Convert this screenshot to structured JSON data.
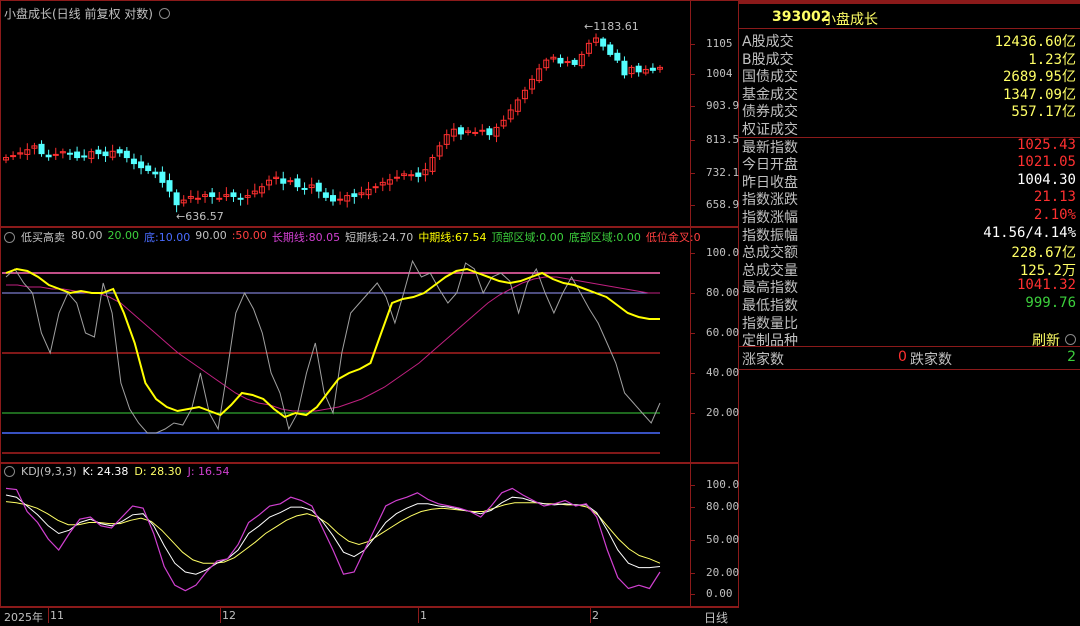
{
  "main_chart": {
    "title": "小盘成长(日线 前复权 对数)",
    "high_label": "1183.61",
    "low_label": "636.57",
    "y_ticks": [
      "1105",
      "1004",
      "903.9",
      "813.5",
      "732.1",
      "658.9"
    ]
  },
  "indicator1": {
    "name": "低买高卖",
    "items": [
      {
        "text": "80.00",
        "color": "#c0c0c0"
      },
      {
        "text": "20.00",
        "color": "#3cd03c"
      },
      {
        "text": "底:10.00",
        "color": "#4a6cff"
      },
      {
        "text": "90.00",
        "color": "#c0c0c0"
      },
      {
        "text": ":50.00",
        "color": "#ff4040"
      },
      {
        "text": "长期线:80.05",
        "color": "#d040d0"
      },
      {
        "text": "短期线:24.70",
        "color": "#c0c0c0"
      },
      {
        "text": "中期线:67.54",
        "color": "#ffff00"
      },
      {
        "text": "顶部区域:0.00",
        "color": "#3cd03c"
      },
      {
        "text": "底部区域:0.00",
        "color": "#3cd03c"
      },
      {
        "text": "低位金叉:0",
        "color": "#ff4040"
      }
    ],
    "y_ticks": [
      "100.0",
      "80.00",
      "60.00",
      "40.00",
      "20.00"
    ]
  },
  "indicator2": {
    "name": "KDJ(9,3,3)",
    "k": "K: 24.38",
    "d": "D: 28.30",
    "j": "J: 16.54",
    "y_ticks": [
      "100.0",
      "80.00",
      "50.00",
      "20.00",
      "0.00"
    ]
  },
  "xaxis": {
    "labels": [
      "2025年",
      "11",
      "12",
      "1",
      "2"
    ],
    "period": "日线"
  },
  "quote": {
    "code": "393002",
    "name": "小盘成长",
    "rows": [
      {
        "label": "A股成交",
        "value": "12436.60亿",
        "color": "#ffff66"
      },
      {
        "label": "B股成交",
        "value": "1.23亿",
        "color": "#ffff66"
      },
      {
        "label": "国债成交",
        "value": "2689.95亿",
        "color": "#ffff66"
      },
      {
        "label": "基金成交",
        "value": "1347.09亿",
        "color": "#ffff66"
      },
      {
        "label": "债券成交",
        "value": "557.17亿",
        "color": "#ffff66"
      },
      {
        "label": "权证成交",
        "value": "",
        "color": "#ffff66"
      },
      {
        "label": "最新指数",
        "value": "1025.43",
        "color": "#ff3030"
      },
      {
        "label": "今日开盘",
        "value": "1021.05",
        "color": "#ff3030"
      },
      {
        "label": "昨日收盘",
        "value": "1004.30",
        "color": "#ffffff"
      },
      {
        "label": "指数涨跌",
        "value": "21.13",
        "color": "#ff3030"
      },
      {
        "label": "指数涨幅",
        "value": "2.10%",
        "color": "#ff3030"
      },
      {
        "label": "指数振幅",
        "value": "41.56/4.14%",
        "color": "#ffffff"
      },
      {
        "label": "总成交额",
        "value": "228.67亿",
        "color": "#ffff66"
      },
      {
        "label": "总成交量",
        "value": "125.2万",
        "color": "#ffff66"
      },
      {
        "label": "最高指数",
        "value": "1041.32",
        "color": "#ff3030"
      },
      {
        "label": "最低指数",
        "value": "999.76",
        "color": "#3cd03c"
      },
      {
        "label": "指数量比",
        "value": "",
        "color": "#ffffff"
      },
      {
        "label": "定制品种",
        "value": "刷新",
        "color": "#ffff66"
      }
    ],
    "rise_label": "涨家数",
    "rise_value": "0",
    "fall_label": "跌家数",
    "fall_value": "2"
  }
}
